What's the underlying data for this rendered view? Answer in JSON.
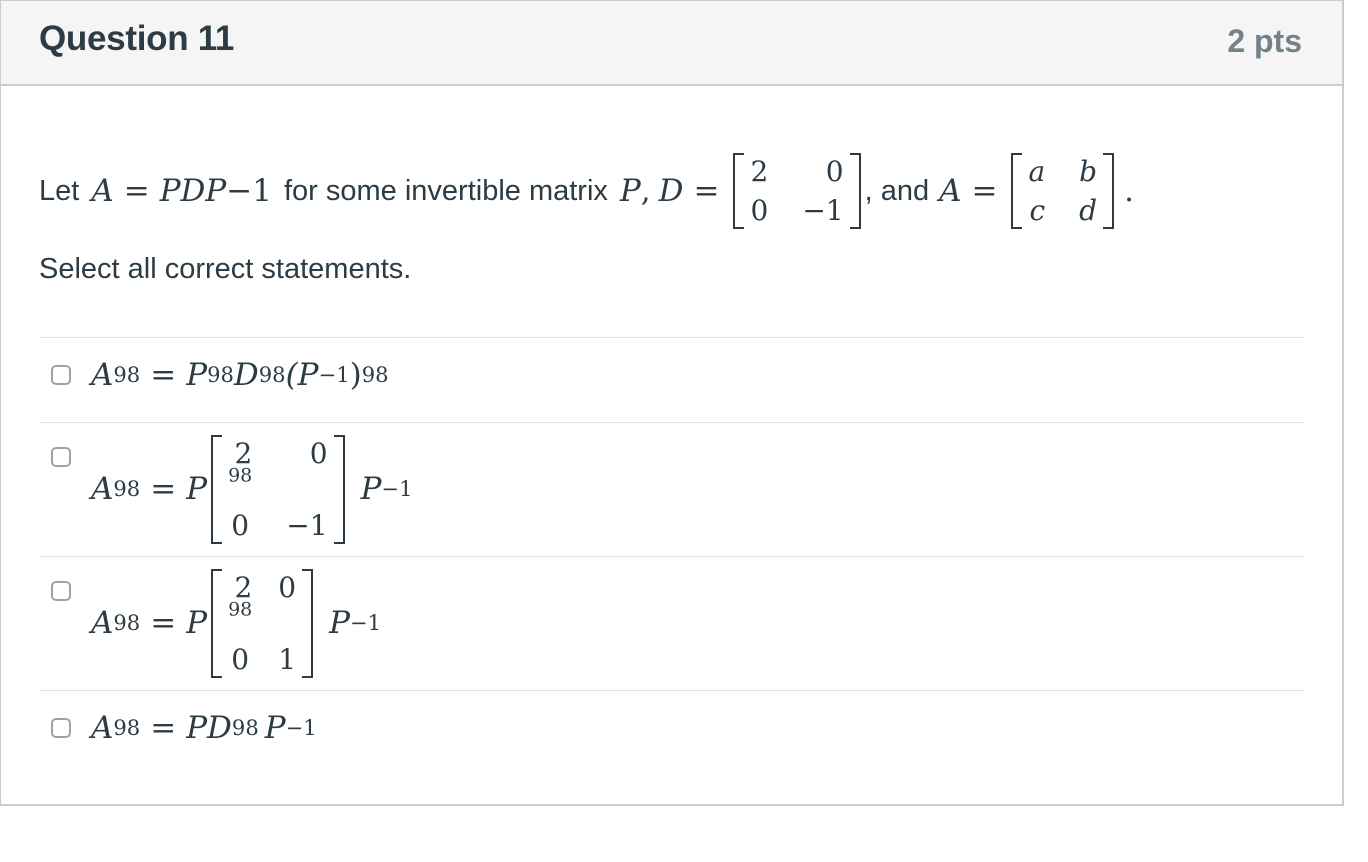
{
  "question": {
    "title": "Question 11",
    "points": "2 pts"
  },
  "stem": {
    "let": "Let",
    "for_some": "for some invertible matrix",
    "and": ", and",
    "instruction": "Select all correct statements."
  },
  "math": {
    "A": "A",
    "P": "P",
    "D": "D",
    "PDP": "PDP",
    "inv": "−1",
    "eq": "=",
    "comma": ",",
    "period": ".",
    "D_matrix": [
      "2",
      "0",
      "0",
      "−1"
    ],
    "A_matrix": [
      "a",
      "b",
      "c",
      "d"
    ]
  },
  "answers": [
    {
      "lhs": "A",
      "lhs_exp": "98",
      "rhs": "P",
      "rhs_exp": "98",
      "mid": "D",
      "mid_exp": "98",
      "paren": "(P",
      "paren_inv": "−1",
      "paren_close": ")",
      "paren_exp": "98"
    },
    {
      "lhs": "A",
      "lhs_exp": "98",
      "pre": "P",
      "matrix": [
        "2",
        "98",
        "0",
        "0",
        "−1"
      ],
      "post": "P",
      "post_exp": "−1"
    },
    {
      "lhs": "A",
      "lhs_exp": "98",
      "pre": "P",
      "matrix": [
        "2",
        "98",
        "0",
        "0",
        "1"
      ],
      "post": "P",
      "post_exp": "−1"
    },
    {
      "lhs": "A",
      "lhs_exp": "98",
      "rhs": "PD",
      "rhs_exp": "98",
      "post": "P",
      "post_exp": "−1"
    }
  ]
}
